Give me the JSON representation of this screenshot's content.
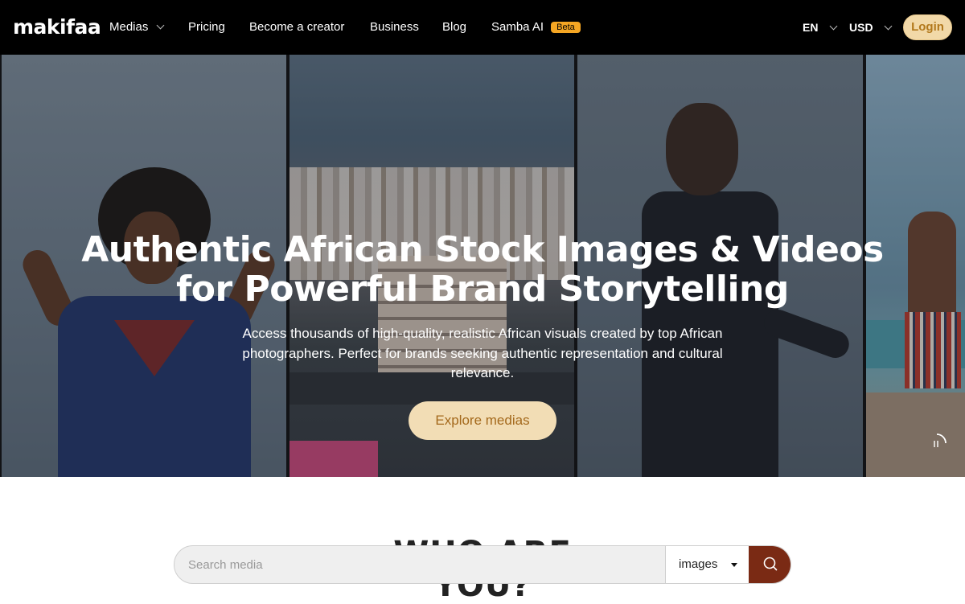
{
  "nav": {
    "logo": "makifaa",
    "items": [
      {
        "label": "Medias",
        "has_dropdown": true
      },
      {
        "label": "Pricing"
      },
      {
        "label": "Become a creator"
      },
      {
        "label": "Business"
      },
      {
        "label": "Blog"
      },
      {
        "label": "Samba AI"
      }
    ],
    "beta_badge": "Beta",
    "language": "EN",
    "currency": "USD",
    "login_label": "Login"
  },
  "hero": {
    "title": "Authentic African Stock Images & Videos for Powerful Brand Storytelling",
    "subtitle": "Access thousands of high-quality, realistic African visuals created by top African photographers. Perfect for brands seeking authentic representation and cultural relevance.",
    "cta_label": "Explore medias"
  },
  "section": {
    "title": "WHO ARE YOU?"
  },
  "search": {
    "placeholder": "Search media",
    "value": "",
    "type_selected": "images"
  },
  "colors": {
    "navbar_bg": "#000000",
    "login_bg": "#f2d9a8",
    "login_text": "#b2781b",
    "beta_bg": "#f5a623",
    "cta_bg": "#f2ddb5",
    "search_button_bg": "#7a2a14"
  },
  "icons": {
    "nav_dropdown": "chevron-down-icon",
    "search_button": "search-icon",
    "slideshow_control": "pause-icon"
  }
}
